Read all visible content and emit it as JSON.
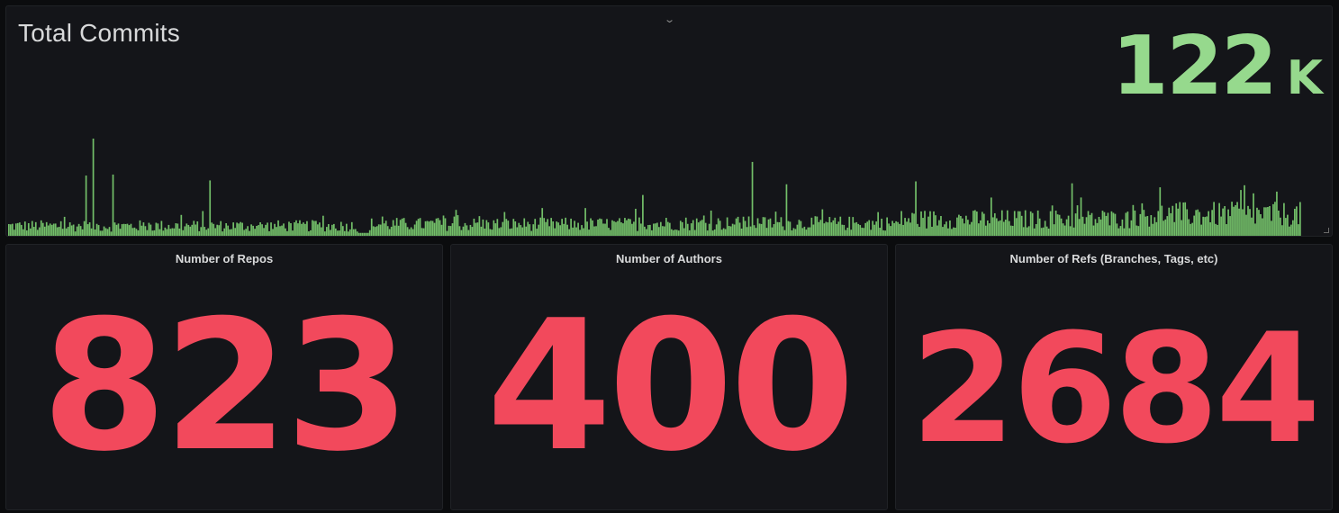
{
  "total_commits": {
    "title": "Total Commits",
    "value": "122",
    "unit": "K",
    "value_color": "#96d98d",
    "collapse_icon": "chevron-down-icon"
  },
  "stats": {
    "repos": {
      "title": "Number of Repos",
      "value": "823"
    },
    "authors": {
      "title": "Number of Authors",
      "value": "400"
    },
    "refs": {
      "title": "Number of Refs (Branches, Tags, etc)",
      "value": "2684"
    },
    "value_color": "#f2495c"
  },
  "chart_data": {
    "type": "bar",
    "series": [
      {
        "values": []
      }
    ],
    "profile": {
      "note_units": "relative height of sparkline bars (0-1)",
      "n_bars": 720,
      "baseline": 0.12,
      "segments": [
        {
          "from": 0.0,
          "to": 0.27,
          "level": 0.12
        },
        {
          "from": 0.27,
          "to": 0.49,
          "level": 0.14
        },
        {
          "from": 0.49,
          "to": 0.69,
          "level": 0.15
        },
        {
          "from": 0.69,
          "to": 0.87,
          "level": 0.2
        },
        {
          "from": 0.87,
          "to": 1.0,
          "level": 0.26
        }
      ],
      "spikes": [
        {
          "at": 0.065,
          "value": 1.0
        },
        {
          "at": 0.06,
          "value": 0.62
        },
        {
          "at": 0.08,
          "value": 0.63
        },
        {
          "at": 0.156,
          "value": 0.57
        },
        {
          "at": 0.49,
          "value": 0.42
        },
        {
          "at": 0.575,
          "value": 0.76
        },
        {
          "at": 0.602,
          "value": 0.53
        },
        {
          "at": 0.702,
          "value": 0.56
        },
        {
          "at": 0.822,
          "value": 0.54
        },
        {
          "at": 0.955,
          "value": 0.52
        }
      ]
    },
    "color": "#73bf69"
  }
}
